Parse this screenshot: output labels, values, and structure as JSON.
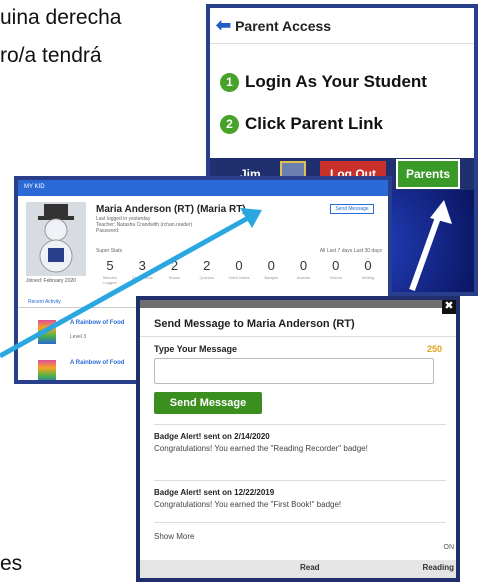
{
  "background_text": {
    "line1": "uina derecha",
    "line2": "ro/a tendrá",
    "line3": "es"
  },
  "parent_panel": {
    "header_title": "Parent Access",
    "step1_number": "1",
    "step1_label": "Login As Your Student",
    "step2_number": "2",
    "step2_label": "Click Parent Link",
    "nav_name": "Jim",
    "logout_label": "Log Out",
    "parents_label": "Parents"
  },
  "kid_panel": {
    "top_nav": "MY KID",
    "name": "Maria Anderson (RT) (Maria RT)",
    "meta_line1": "Last logged in yesterday",
    "meta_line2": "Teacher:  Natasha Crandwith (rchan.reader)",
    "meta_line3": "Password:",
    "send_button": "Send Message",
    "joined": "Joined: February 2020",
    "stats_title": "Super Stats",
    "stats_range": "All  Last 7 days  Last 30 days",
    "stats": [
      {
        "value": "5",
        "label": "Minutes Logged"
      },
      {
        "value": "3",
        "label": "Check Outs"
      },
      {
        "value": "2",
        "label": "Books"
      },
      {
        "value": "2",
        "label": "Quizzes"
      },
      {
        "value": "0",
        "label": "Voice Notes"
      },
      {
        "value": "0",
        "label": "Badges"
      },
      {
        "value": "0",
        "label": "Awards"
      },
      {
        "value": "0",
        "label": "Videos"
      },
      {
        "value": "0",
        "label": "Writing"
      }
    ],
    "tab_active": "Recent Activity",
    "book1_title": "A Rainbow of Food",
    "book1_level": "Level 3",
    "book2_title": "A Rainbow of Food"
  },
  "message_dialog": {
    "title": "Send Message to Maria Anderson (RT)",
    "input_label": "Type Your Message",
    "char_count": "250",
    "input_value": "",
    "send_button": "Send Message",
    "badges": [
      {
        "header": "Badge Alert! sent on 2/14/2020",
        "body": "Congratulations! You earned the \"Reading Recorder\" badge!"
      },
      {
        "header": "Badge Alert! sent on 12/22/2019",
        "body": "Congratulations! You earned the \"First Book!\" badge!"
      }
    ],
    "show_more": "Show More",
    "footer_left": "Read",
    "footer_right": "Reading",
    "edge_text": "ON"
  },
  "colors": {
    "frame": "#2a3f8c",
    "send_green": "#3a8f1e",
    "arrow_blue": "#2aa7e0",
    "count_orange": "#e3a21a"
  }
}
